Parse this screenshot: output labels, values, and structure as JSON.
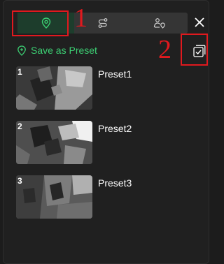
{
  "tabs": [
    {
      "icon": "location-pin-icon",
      "active": true
    },
    {
      "icon": "route-icon",
      "active": false
    },
    {
      "icon": "person-location-icon",
      "active": false
    }
  ],
  "close_icon": "close-icon",
  "save_preset": {
    "label": "Save as Preset",
    "icon": "location-pin-icon"
  },
  "multi_select_icon": "checkbox-stack-icon",
  "annotations": {
    "one": "1",
    "two": "2"
  },
  "presets": [
    {
      "number": "1",
      "name": "Preset1"
    },
    {
      "number": "2",
      "name": "Preset2"
    },
    {
      "number": "3",
      "name": "Preset3"
    }
  ],
  "colors": {
    "accent": "#3ccf73",
    "annotation": "#e0191e",
    "panel": "#202020"
  }
}
